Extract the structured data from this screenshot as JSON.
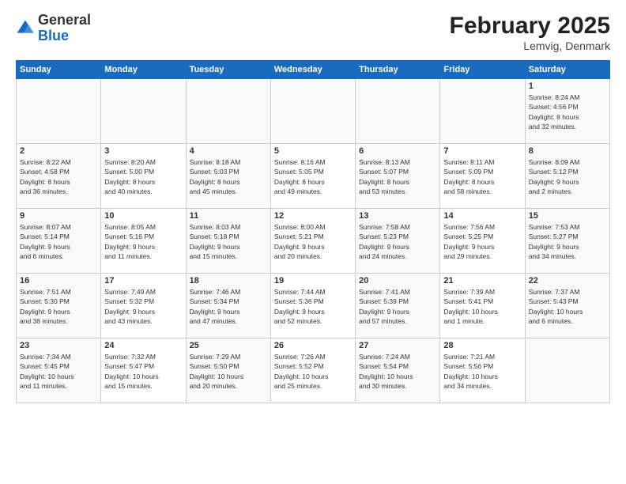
{
  "logo": {
    "general": "General",
    "blue": "Blue"
  },
  "title": "February 2025",
  "subtitle": "Lemvig, Denmark",
  "weekdays": [
    "Sunday",
    "Monday",
    "Tuesday",
    "Wednesday",
    "Thursday",
    "Friday",
    "Saturday"
  ],
  "weeks": [
    [
      {
        "day": "",
        "info": ""
      },
      {
        "day": "",
        "info": ""
      },
      {
        "day": "",
        "info": ""
      },
      {
        "day": "",
        "info": ""
      },
      {
        "day": "",
        "info": ""
      },
      {
        "day": "",
        "info": ""
      },
      {
        "day": "1",
        "info": "Sunrise: 8:24 AM\nSunset: 4:56 PM\nDaylight: 8 hours\nand 32 minutes."
      }
    ],
    [
      {
        "day": "2",
        "info": "Sunrise: 8:22 AM\nSunset: 4:58 PM\nDaylight: 8 hours\nand 36 minutes."
      },
      {
        "day": "3",
        "info": "Sunrise: 8:20 AM\nSunset: 5:00 PM\nDaylight: 8 hours\nand 40 minutes."
      },
      {
        "day": "4",
        "info": "Sunrise: 8:18 AM\nSunset: 5:03 PM\nDaylight: 8 hours\nand 45 minutes."
      },
      {
        "day": "5",
        "info": "Sunrise: 8:16 AM\nSunset: 5:05 PM\nDaylight: 8 hours\nand 49 minutes."
      },
      {
        "day": "6",
        "info": "Sunrise: 8:13 AM\nSunset: 5:07 PM\nDaylight: 8 hours\nand 53 minutes."
      },
      {
        "day": "7",
        "info": "Sunrise: 8:11 AM\nSunset: 5:09 PM\nDaylight: 8 hours\nand 58 minutes."
      },
      {
        "day": "8",
        "info": "Sunrise: 8:09 AM\nSunset: 5:12 PM\nDaylight: 9 hours\nand 2 minutes."
      }
    ],
    [
      {
        "day": "9",
        "info": "Sunrise: 8:07 AM\nSunset: 5:14 PM\nDaylight: 9 hours\nand 6 minutes."
      },
      {
        "day": "10",
        "info": "Sunrise: 8:05 AM\nSunset: 5:16 PM\nDaylight: 9 hours\nand 11 minutes."
      },
      {
        "day": "11",
        "info": "Sunrise: 8:03 AM\nSunset: 5:18 PM\nDaylight: 9 hours\nand 15 minutes."
      },
      {
        "day": "12",
        "info": "Sunrise: 8:00 AM\nSunset: 5:21 PM\nDaylight: 9 hours\nand 20 minutes."
      },
      {
        "day": "13",
        "info": "Sunrise: 7:58 AM\nSunset: 5:23 PM\nDaylight: 9 hours\nand 24 minutes."
      },
      {
        "day": "14",
        "info": "Sunrise: 7:56 AM\nSunset: 5:25 PM\nDaylight: 9 hours\nand 29 minutes."
      },
      {
        "day": "15",
        "info": "Sunrise: 7:53 AM\nSunset: 5:27 PM\nDaylight: 9 hours\nand 34 minutes."
      }
    ],
    [
      {
        "day": "16",
        "info": "Sunrise: 7:51 AM\nSunset: 5:30 PM\nDaylight: 9 hours\nand 38 minutes."
      },
      {
        "day": "17",
        "info": "Sunrise: 7:49 AM\nSunset: 5:32 PM\nDaylight: 9 hours\nand 43 minutes."
      },
      {
        "day": "18",
        "info": "Sunrise: 7:46 AM\nSunset: 5:34 PM\nDaylight: 9 hours\nand 47 minutes."
      },
      {
        "day": "19",
        "info": "Sunrise: 7:44 AM\nSunset: 5:36 PM\nDaylight: 9 hours\nand 52 minutes."
      },
      {
        "day": "20",
        "info": "Sunrise: 7:41 AM\nSunset: 5:39 PM\nDaylight: 9 hours\nand 57 minutes."
      },
      {
        "day": "21",
        "info": "Sunrise: 7:39 AM\nSunset: 5:41 PM\nDaylight: 10 hours\nand 1 minute."
      },
      {
        "day": "22",
        "info": "Sunrise: 7:37 AM\nSunset: 5:43 PM\nDaylight: 10 hours\nand 6 minutes."
      }
    ],
    [
      {
        "day": "23",
        "info": "Sunrise: 7:34 AM\nSunset: 5:45 PM\nDaylight: 10 hours\nand 11 minutes."
      },
      {
        "day": "24",
        "info": "Sunrise: 7:32 AM\nSunset: 5:47 PM\nDaylight: 10 hours\nand 15 minutes."
      },
      {
        "day": "25",
        "info": "Sunrise: 7:29 AM\nSunset: 5:50 PM\nDaylight: 10 hours\nand 20 minutes."
      },
      {
        "day": "26",
        "info": "Sunrise: 7:26 AM\nSunset: 5:52 PM\nDaylight: 10 hours\nand 25 minutes."
      },
      {
        "day": "27",
        "info": "Sunrise: 7:24 AM\nSunset: 5:54 PM\nDaylight: 10 hours\nand 30 minutes."
      },
      {
        "day": "28",
        "info": "Sunrise: 7:21 AM\nSunset: 5:56 PM\nDaylight: 10 hours\nand 34 minutes."
      },
      {
        "day": "",
        "info": ""
      }
    ]
  ]
}
